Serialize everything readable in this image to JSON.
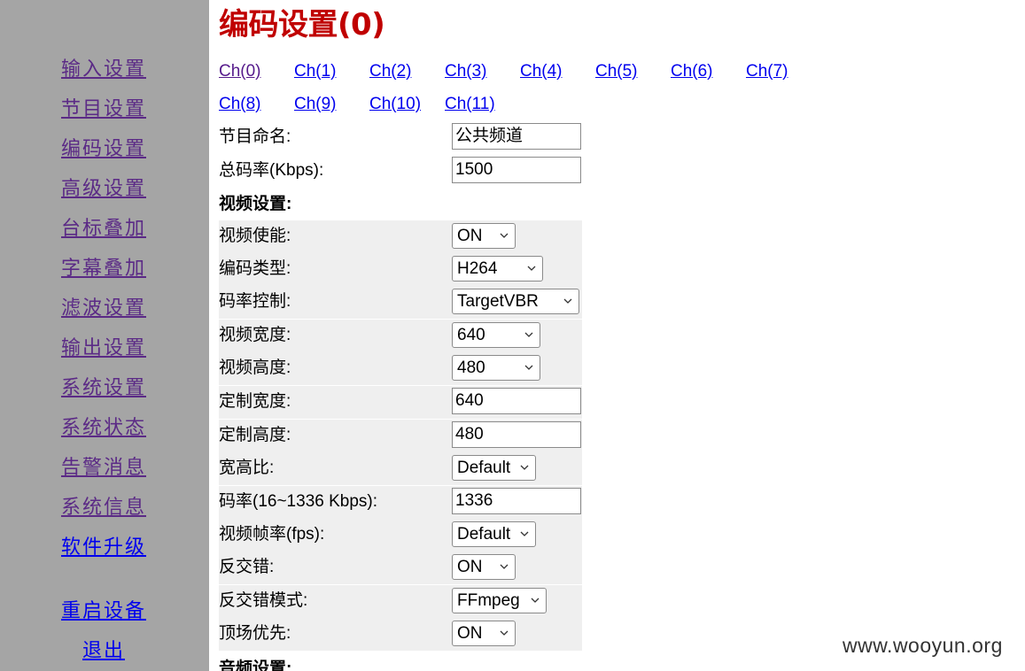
{
  "sidebar": {
    "items": [
      {
        "label": "输入设置"
      },
      {
        "label": "节目设置"
      },
      {
        "label": "编码设置"
      },
      {
        "label": "高级设置"
      },
      {
        "label": "台标叠加"
      },
      {
        "label": "字幕叠加"
      },
      {
        "label": "滤波设置"
      },
      {
        "label": "输出设置"
      },
      {
        "label": "系统设置"
      },
      {
        "label": "系统状态"
      },
      {
        "label": "告警消息"
      },
      {
        "label": "系统信息"
      },
      {
        "label": "软件升级"
      }
    ],
    "reboot_label": "重启设备",
    "logout_label": "退出"
  },
  "main": {
    "title": "编码设置(0)",
    "channels": [
      "Ch(0)",
      "Ch(1)",
      "Ch(2)",
      "Ch(3)",
      "Ch(4)",
      "Ch(5)",
      "Ch(6)",
      "Ch(7)",
      "Ch(8)",
      "Ch(9)",
      "Ch(10)",
      "Ch(11)"
    ],
    "program_name": {
      "label": "节目命名:",
      "value": "公共频道"
    },
    "total_bitrate": {
      "label": "总码率(Kbps):",
      "value": "1500"
    },
    "video_section": "视频设置:",
    "video": {
      "enable": {
        "label": "视频使能:",
        "value": "ON"
      },
      "codec": {
        "label": "编码类型:",
        "value": "H264"
      },
      "rate_control": {
        "label": "码率控制:",
        "value": "TargetVBR"
      },
      "width": {
        "label": "视频宽度:",
        "value": "640"
      },
      "height": {
        "label": "视频高度:",
        "value": "480"
      },
      "custom_width": {
        "label": "定制宽度:",
        "value": "640"
      },
      "custom_height": {
        "label": "定制高度:",
        "value": "480"
      },
      "aspect": {
        "label": "宽高比:",
        "value": "Default"
      },
      "bitrate": {
        "label": "码率(16~1336 Kbps):",
        "value": "1336"
      },
      "fps": {
        "label": "视频帧率(fps):",
        "value": "Default"
      },
      "deinterlace": {
        "label": "反交错:",
        "value": "ON"
      },
      "deinterlace_mode": {
        "label": "反交错模式:",
        "value": "FFmpeg"
      },
      "top_field_first": {
        "label": "顶场优先:",
        "value": "ON"
      }
    },
    "audio_section": "音频设置:"
  },
  "watermark": "www.wooyun.org"
}
